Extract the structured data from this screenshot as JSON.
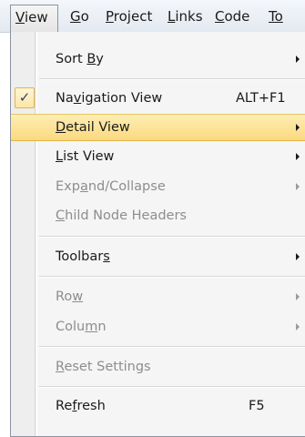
{
  "menubar": {
    "items": [
      {
        "pre": "",
        "acc": "V",
        "post": "iew"
      },
      {
        "pre": "",
        "acc": "G",
        "post": "o"
      },
      {
        "pre": "",
        "acc": "P",
        "post": "roject"
      },
      {
        "pre": "",
        "acc": "L",
        "post": "inks"
      },
      {
        "pre": "",
        "acc": "C",
        "post": "ode"
      },
      {
        "pre": "",
        "acc": "To",
        "post": ""
      }
    ]
  },
  "menu": {
    "items": [
      {
        "pre": "Sort ",
        "acc": "B",
        "post": "y",
        "shortcut": "",
        "submenu": true
      },
      {
        "pre": "Na",
        "acc": "v",
        "post": "igation View",
        "shortcut": "ALT+F1",
        "checked": true,
        "check_glyph": "✓"
      },
      {
        "pre": "",
        "acc": "D",
        "post": "etail View",
        "shortcut": "",
        "submenu": true
      },
      {
        "pre": "",
        "acc": "L",
        "post": "ist View",
        "shortcut": "",
        "submenu": true
      },
      {
        "pre": "Exp",
        "acc": "a",
        "post": "nd/Collapse",
        "shortcut": "",
        "submenu": true,
        "disabled": true
      },
      {
        "pre": "",
        "acc": "C",
        "post": "hild Node Headers",
        "shortcut": "",
        "disabled": true
      },
      {
        "pre": "Toolbar",
        "acc": "s",
        "post": "",
        "shortcut": "",
        "submenu": true
      },
      {
        "pre": "Ro",
        "acc": "w",
        "post": "",
        "shortcut": "",
        "submenu": true,
        "disabled": true
      },
      {
        "pre": "Colu",
        "acc": "m",
        "post": "n",
        "shortcut": "",
        "submenu": true,
        "disabled": true
      },
      {
        "pre": "",
        "acc": "R",
        "post": "eset Settings",
        "shortcut": "",
        "disabled": true
      },
      {
        "pre": "Re",
        "acc": "f",
        "post": "resh",
        "shortcut": "F5"
      }
    ]
  }
}
